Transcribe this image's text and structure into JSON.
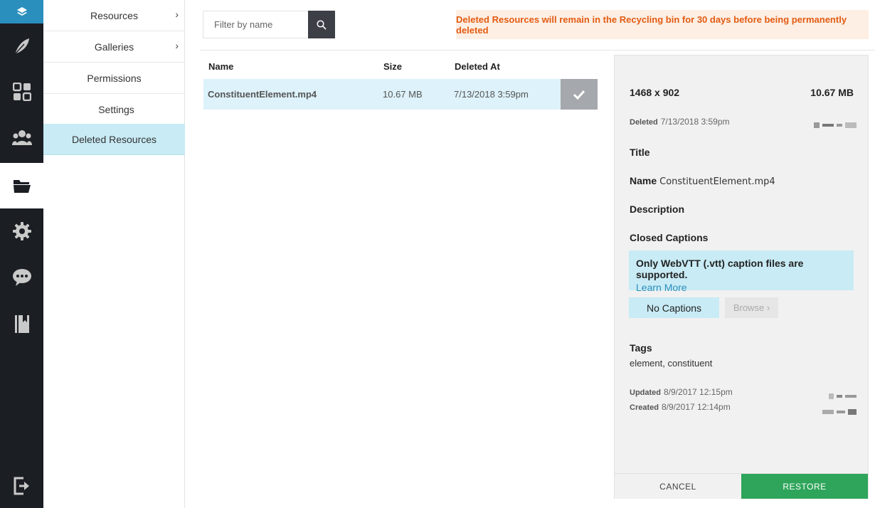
{
  "colors": {
    "rail_bg": "#1b1e23",
    "accent_blue": "#2b8fbd",
    "active_bg": "#c8ebf5",
    "restore_green": "#2ea55a",
    "notice_text": "#e35b12"
  },
  "rail": {
    "icons": [
      "layers-icon",
      "feather-icon",
      "dashboard-icon",
      "users-icon",
      "folder-icon",
      "gear-icon",
      "chat-icon",
      "book-icon",
      "logout-icon"
    ],
    "active": "folder-icon"
  },
  "subnav": {
    "items": [
      {
        "label": "Resources",
        "chevron": "›"
      },
      {
        "label": "Galleries",
        "chevron": "›"
      },
      {
        "label": "Permissions"
      },
      {
        "label": "Settings"
      },
      {
        "label": "Deleted Resources"
      }
    ],
    "active": "Deleted Resources"
  },
  "search": {
    "placeholder": "Filter by name",
    "value": ""
  },
  "notice": "Deleted Resources will remain in the Recycling bin for 30 days before being permanently deleted",
  "table": {
    "headers": [
      "Name",
      "Size",
      "Deleted At"
    ],
    "rows": [
      {
        "name": "ConstituentElement.mp4",
        "size": "10.67 MB",
        "deleted_at": "7/13/2018 3:59pm",
        "selected": true
      }
    ]
  },
  "detail": {
    "dimensions": "1468 x 902",
    "size": "10.67 MB",
    "deleted_label": "Deleted",
    "deleted_value": "7/13/2018 3:59pm",
    "title_label": "Title",
    "name_label": "Name",
    "name_value": "ConstituentElement.mp4",
    "description_label": "Description",
    "closed_captions_label": "Closed Captions",
    "captions_note": "Only WebVTT (.vtt) caption files are supported.",
    "learn_more": "Learn More",
    "no_captions": "No Captions",
    "browse": "Browse",
    "browse_chevron": "›",
    "tags_label": "Tags",
    "tags_value": "element, constituent",
    "updated_label": "Updated",
    "updated_value": "8/9/2017 12:15pm",
    "created_label": "Created",
    "created_value": "8/9/2017 12:14pm",
    "cancel": "CANCEL",
    "restore": "RESTORE"
  }
}
